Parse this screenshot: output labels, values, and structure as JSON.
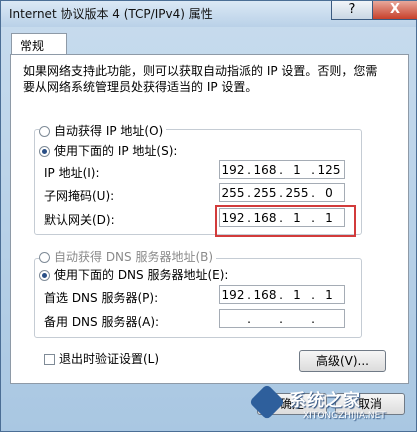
{
  "window": {
    "title": "Internet 协议版本 4 (TCP/IPv4) 属性",
    "help_label": "?",
    "close_label": "X"
  },
  "tabs": [
    {
      "label": "常规"
    }
  ],
  "description": "如果网络支持此功能，则可以获取自动指派的 IP 设置。否则，您需要从网络系统管理员处获得适当的 IP 设置。",
  "ip_mode": {
    "auto_label": "自动获得 IP 地址(O)",
    "manual_label": "使用下面的 IP 地址(S):",
    "selected": "manual"
  },
  "ip_fields": {
    "ip_address": {
      "label": "IP 地址(I):",
      "octets": [
        "192",
        "168",
        "1",
        "125"
      ]
    },
    "subnet_mask": {
      "label": "子网掩码(U):",
      "octets": [
        "255",
        "255",
        "255",
        "0"
      ]
    },
    "default_gateway": {
      "label": "默认网关(D):",
      "octets": [
        "192",
        "168",
        "1",
        "1"
      ]
    }
  },
  "dns_mode": {
    "auto_label": "自动获得 DNS 服务器地址(B)",
    "manual_label": "使用下面的 DNS 服务器地址(E):",
    "selected": "manual"
  },
  "dns_fields": {
    "preferred": {
      "label": "首选 DNS 服务器(P):",
      "octets": [
        "192",
        "168",
        "1",
        "1"
      ]
    },
    "alternate": {
      "label": "备用 DNS 服务器(A):",
      "octets": [
        "",
        "",
        "",
        ""
      ]
    }
  },
  "validate_on_exit": {
    "label": "退出时验证设置(L)",
    "checked": false
  },
  "advanced_button": "高级(V)...",
  "ok_button": "确定",
  "cancel_button": "取消",
  "watermark": {
    "text": "系统之家",
    "url": "XITONGZHIJIA.NET"
  },
  "colors": {
    "highlight_box": "#d23b3b",
    "title_gradient": "#c8dcee"
  }
}
